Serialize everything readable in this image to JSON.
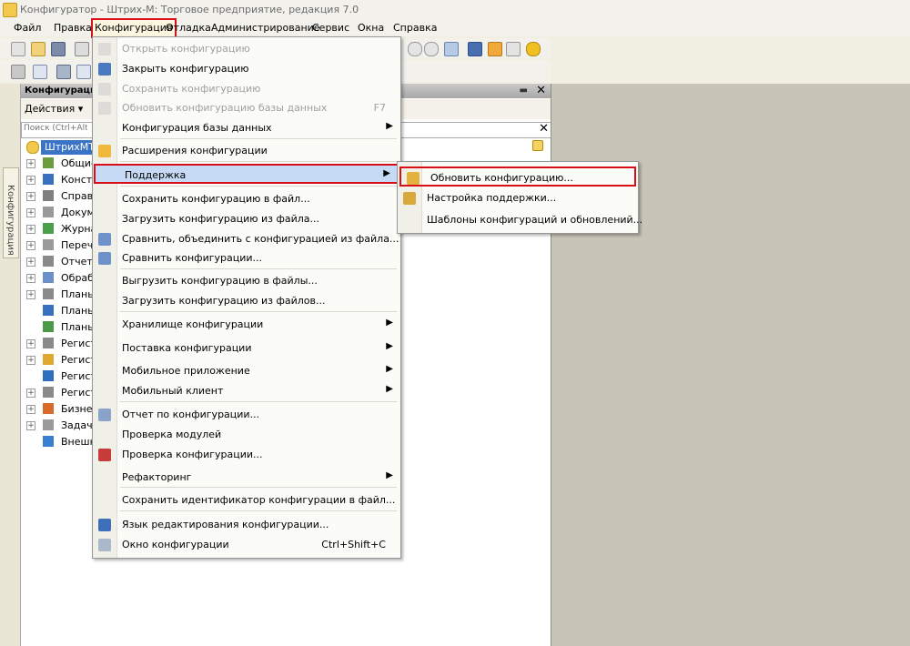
{
  "window": {
    "title": "Конфигуратор - Штрих-М: Торговое предприятие, редакция 7.0"
  },
  "menubar": {
    "items": [
      "Файл",
      "Правка",
      "Конфигурация",
      "Отладка",
      "Администрирование",
      "Сервис",
      "Окна",
      "Справка"
    ],
    "selected": "Конфигурация"
  },
  "left_tab": {
    "label": "Конфигурация"
  },
  "config_panel": {
    "title": "Конфигурация",
    "actions_label": "Действия",
    "search_placeholder": "Поиск (Ctrl+Alt+I)",
    "root_label": "ШтрихМТорговое",
    "tree": [
      {
        "label": "Общие",
        "icon": "common-icon",
        "expandable": true
      },
      {
        "label": "Константы",
        "icon": "constants-icon",
        "expandable": true
      },
      {
        "label": "Справочники",
        "icon": "catalogs-icon",
        "expandable": true
      },
      {
        "label": "Документы",
        "icon": "documents-icon",
        "expandable": true
      },
      {
        "label": "Журналы документов",
        "icon": "journals-icon",
        "expandable": true
      },
      {
        "label": "Перечисления",
        "icon": "enums-icon",
        "expandable": true
      },
      {
        "label": "Отчеты",
        "icon": "reports-icon",
        "expandable": true
      },
      {
        "label": "Обработки",
        "icon": "processing-icon",
        "expandable": true
      },
      {
        "label": "Планы видов характеристик",
        "icon": "char-types-icon",
        "expandable": true
      },
      {
        "label": "Планы счетов",
        "icon": "accounts-icon",
        "expandable": false
      },
      {
        "label": "Планы видов расчета",
        "icon": "calc-types-icon",
        "expandable": false
      },
      {
        "label": "Регистры сведений",
        "icon": "info-registers-icon",
        "expandable": true
      },
      {
        "label": "Регистры накопления",
        "icon": "accum-registers-icon",
        "expandable": true
      },
      {
        "label": "Регистры бухгалтерии",
        "icon": "accounting-registers-icon",
        "expandable": false
      },
      {
        "label": "Регистры расчета",
        "icon": "calc-registers-icon",
        "expandable": true
      },
      {
        "label": "Бизнес-процессы",
        "icon": "business-process-icon",
        "expandable": true
      },
      {
        "label": "Задачи",
        "icon": "tasks-icon",
        "expandable": true
      },
      {
        "label": "Внешние источники данных",
        "icon": "external-sources-icon",
        "expandable": false
      }
    ]
  },
  "config_menu": {
    "items": [
      {
        "label": "Открыть конфигурацию",
        "disabled": true,
        "icon": "open-config-icon"
      },
      {
        "label": "Закрыть конфигурацию",
        "icon": "close-config-icon"
      },
      {
        "label": "Сохранить конфигурацию",
        "disabled": true,
        "icon": "save-config-icon"
      },
      {
        "label": "Обновить конфигурацию базы данных",
        "disabled": true,
        "shortcut": "F7",
        "icon": "update-db-icon"
      },
      {
        "label": "Конфигурация базы данных",
        "submenu": true
      },
      {
        "label": "Расширения конфигурации",
        "icon": "extensions-icon"
      },
      {
        "label": "Поддержка",
        "submenu": true,
        "selected": true
      },
      {
        "label": "Сохранить конфигурацию в файл..."
      },
      {
        "label": "Загрузить конфигурацию из файла..."
      },
      {
        "label": "Сравнить, объединить с конфигурацией из файла...",
        "icon": "compare-merge-icon"
      },
      {
        "label": "Сравнить конфигурации...",
        "icon": "compare-icon"
      },
      {
        "label": "Выгрузить конфигурацию в файлы..."
      },
      {
        "label": "Загрузить конфигурацию из файлов..."
      },
      {
        "label": "Хранилище конфигурации",
        "submenu": true
      },
      {
        "label": "Поставка конфигурации",
        "submenu": true
      },
      {
        "label": "Мобильное приложение",
        "submenu": true
      },
      {
        "label": "Мобильный клиент",
        "submenu": true
      },
      {
        "label": "Отчет по конфигурации...",
        "icon": "report-icon"
      },
      {
        "label": "Проверка модулей"
      },
      {
        "label": "Проверка конфигурации...",
        "icon": "check-config-icon"
      },
      {
        "label": "Рефакторинг",
        "submenu": true
      },
      {
        "label": "Сохранить идентификатор конфигурации в файл..."
      },
      {
        "label": "Язык редактирования конфигурации...",
        "icon": "language-icon"
      },
      {
        "label": "Окно конфигурации",
        "shortcut": "Ctrl+Shift+C",
        "icon": "config-window-icon"
      }
    ]
  },
  "support_submenu": {
    "items": [
      {
        "label": "Обновить конфигурацию...",
        "highlighted": true,
        "icon": "update-config-icon"
      },
      {
        "label": "Настройка поддержки...",
        "icon": "support-settings-icon"
      },
      {
        "label": "Шаблоны конфигураций и обновлений..."
      }
    ]
  },
  "colors": {
    "highlight_border": "#d90f17",
    "selection_bg": "#c6daf5",
    "tree_selected_bg": "#3b73c5",
    "right_pane_bg": "#c8c5b7"
  }
}
